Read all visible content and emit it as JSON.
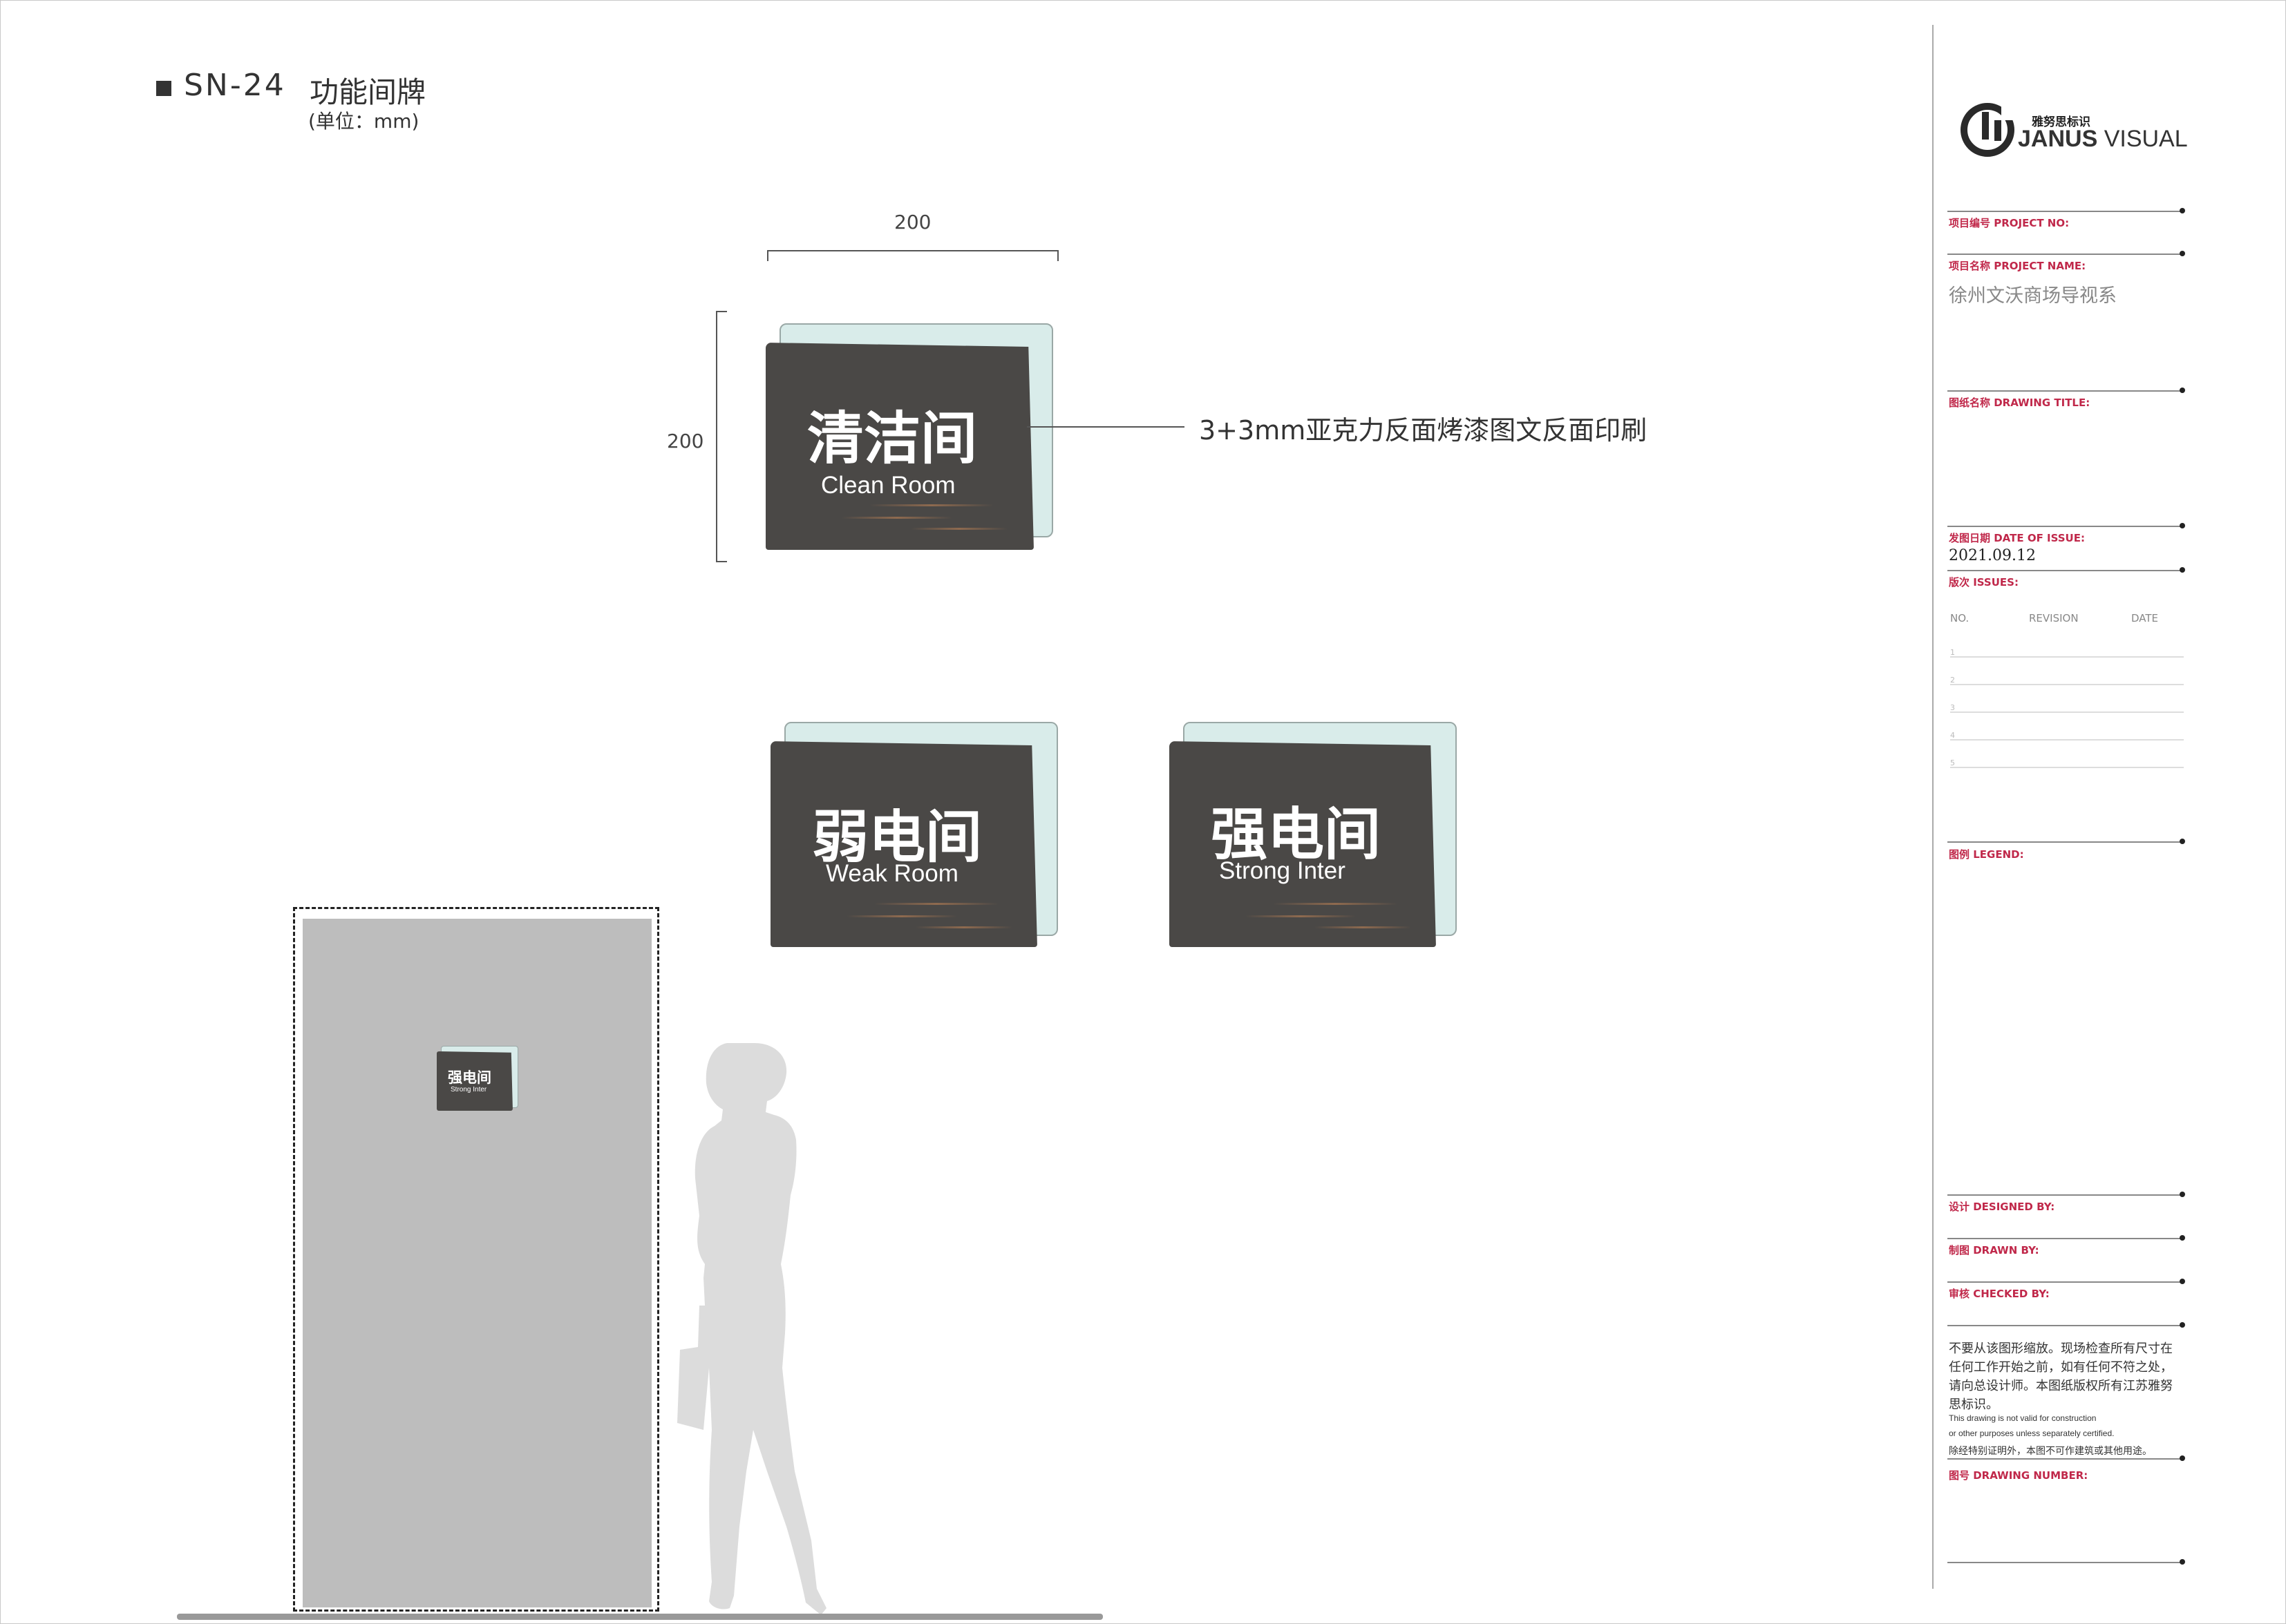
{
  "header": {
    "code": "SN-24",
    "name": "功能间牌",
    "unit": "(单位：mm)"
  },
  "dimensions": {
    "width_label": "200",
    "height_label": "200"
  },
  "callout": "3+3mm亚克力反面烤漆图文反面印刷",
  "signs": [
    {
      "zh": "清洁间",
      "en": "Clean Room"
    },
    {
      "zh": "弱电间",
      "en": "Weak Room"
    },
    {
      "zh": "强电间",
      "en": "Strong Inter"
    }
  ],
  "door_sign": {
    "zh": "强电间",
    "en": "Strong Inter"
  },
  "title_block": {
    "brand_small": "雅努思标识",
    "brand_bold": "JANUS",
    "brand_light": " VISUAL",
    "project_no_label": "项目编号  PROJECT NO:",
    "project_name_label": "项目名称  PROJECT NAME:",
    "project_name_value": "徐州文沃商场导视系",
    "drawing_title_label": "图纸名称  DRAWING TITLE:",
    "date_label": "发图日期  DATE OF ISSUE:",
    "date_value": "2021.09.12",
    "issues_label": "版次  ISSUES:",
    "rev_headers": [
      "NO.",
      "REVISION",
      "DATE"
    ],
    "rev_rows": [
      "1",
      "2",
      "3",
      "4",
      "5"
    ],
    "legend_label": "图例  LEGEND:",
    "designed_label": "设计  DESIGNED BY:",
    "drawn_label": "制图  DRAWN BY:",
    "checked_label": "审核  CHECKED BY:",
    "note_zh": [
      "不要从该图形缩放。现场检查所有尺寸在",
      "任何工作开始之前，如有任何不符之处，",
      "请向总设计师。本图纸版权所有江苏雅努",
      "思标识。"
    ],
    "note_en": [
      "This drawing is not valid for construction",
      "or other purposes unless separately certified."
    ],
    "note_zh2": "除经特别证明外，本图不可作建筑或其他用途。",
    "drawing_number_label": "图号  DRAWING NUMBER:"
  },
  "colors": {
    "sign_face": "#4a4846",
    "sign_back": "#d9ecea",
    "accent_red": "#c0284a",
    "door": "#bdbdbd",
    "figure": "#dcdcdc"
  }
}
